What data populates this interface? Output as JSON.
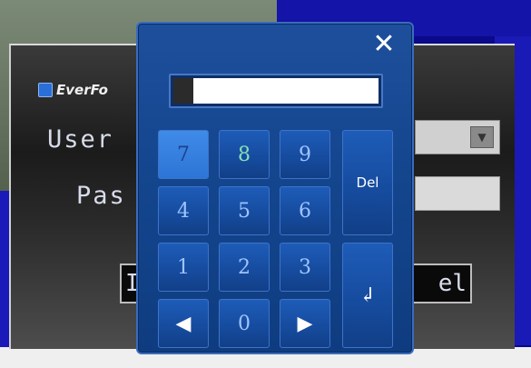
{
  "login": {
    "logo_text": "EverFo",
    "user_label": "User",
    "password_label": "Pas",
    "left_button_fragment": "I",
    "right_button_fragment": "el"
  },
  "keypad": {
    "close_glyph": "✕",
    "keys": {
      "k7": "7",
      "k8": "8",
      "k9": "9",
      "k4": "4",
      "k5": "5",
      "k6": "6",
      "k1": "1",
      "k2": "2",
      "k3": "3",
      "k0": "0",
      "del": "Del",
      "left": "◀",
      "right": "▶",
      "enter": "↲"
    }
  },
  "icons": {
    "close": "close-icon",
    "enter": "enter-icon",
    "left": "arrow-left-icon",
    "right": "arrow-right-icon",
    "combo": "chevron-down-icon"
  }
}
